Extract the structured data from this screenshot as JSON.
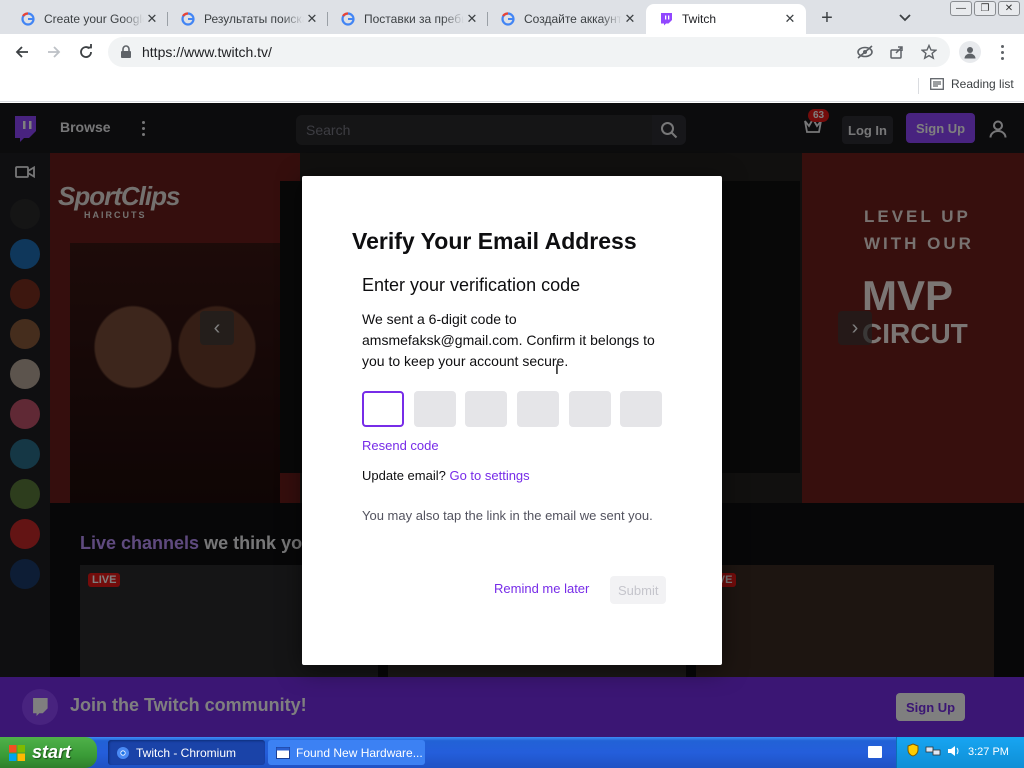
{
  "browser": {
    "tabs": [
      {
        "title": "Create your Google",
        "icon": "google-g-icon"
      },
      {
        "title": "Результаты поиска",
        "icon": "google-g-icon"
      },
      {
        "title": "Поставки за пребы",
        "icon": "google-g-icon"
      },
      {
        "title": "Создайте аккаунт",
        "icon": "google-g-icon"
      },
      {
        "title": "Twitch",
        "icon": "twitch-icon",
        "active": true
      }
    ],
    "url": "https://www.twitch.tv/",
    "reading_list": "Reading list"
  },
  "twitch": {
    "browse": "Browse",
    "search_placeholder": "Search",
    "prime_badge": "63",
    "login": "Log In",
    "signup": "Sign Up",
    "hero": {
      "brand": "SportClips",
      "brand_sub": "HAIRCUTS",
      "right_line1": "LEVEL UP",
      "right_line2": "WITH OUR",
      "right_big": "MVP",
      "right_big2": "CIRCUT"
    },
    "live_title_highlight": "Live channels",
    "live_title_rest": " we think you",
    "live_tag": "LIVE",
    "banner_text": "Join the Twitch community!",
    "banner_button": "Sign Up"
  },
  "modal": {
    "title": "Verify Your Email Address",
    "subtitle": "Enter your verification code",
    "body": "We sent a 6-digit code to amsmefaksk@gmail.com. Confirm it belongs to you to keep your account secure.",
    "resend": "Resend code",
    "update_prefix": "Update email? ",
    "update_link": "Go to settings",
    "note": "You may also tap the link in the email we sent you.",
    "remind_later": "Remind me later",
    "submit": "Submit",
    "accent": "#772ce8"
  },
  "taskbar": {
    "start": "start",
    "tasks": [
      {
        "label": "Twitch - Chromium",
        "active": true
      },
      {
        "label": "Found New Hardware...",
        "active": false
      }
    ],
    "clock": "3:27 PM"
  }
}
